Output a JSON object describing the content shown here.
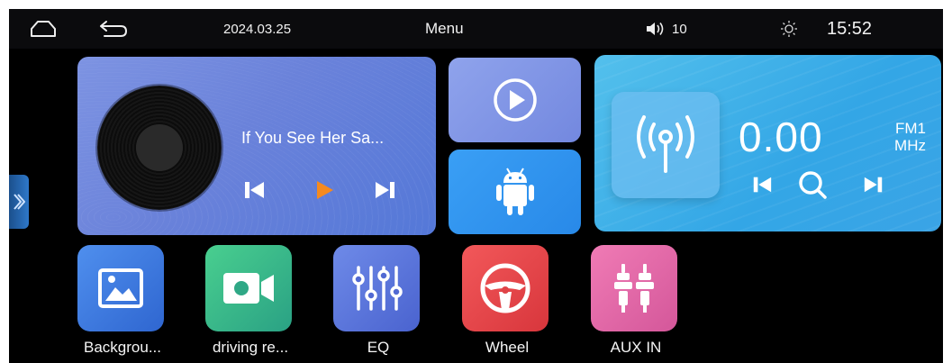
{
  "status_bar": {
    "home_icon": "home-icon",
    "back_icon": "back-arrow-icon",
    "date": "2024.03.25",
    "title": "Menu",
    "volume_icon": "speaker-icon",
    "volume": "10",
    "brightness_icon": "sun-icon",
    "time": "15:52"
  },
  "side_tab": {
    "icon": "chevron-right-icon"
  },
  "music": {
    "song_title": "If You See Her Sa...",
    "controls": [
      "previous-icon",
      "play-icon",
      "next-icon"
    ],
    "play_color": "#f58a1f"
  },
  "tiles": [
    {
      "name": "video-player",
      "icon": "play-circle-icon"
    },
    {
      "name": "android-auto",
      "icon": "android-icon"
    }
  ],
  "radio": {
    "frequency": "0.00",
    "band": "FM1",
    "unit": "MHz",
    "controls": [
      "previous-icon",
      "search-icon",
      "next-icon"
    ]
  },
  "apps": [
    {
      "label": "Backgrou...",
      "icon": "image-icon",
      "color": "#3f7fe0"
    },
    {
      "label": "driving re...",
      "icon": "camera-icon",
      "color": "#36b88c"
    },
    {
      "label": "EQ",
      "icon": "equalizer-icon",
      "color": "#5a74dc"
    },
    {
      "label": "Wheel",
      "icon": "steering-wheel-icon",
      "color": "#e8474b"
    },
    {
      "label": "AUX IN",
      "icon": "aux-plug-icon",
      "color": "#e467a7"
    }
  ]
}
